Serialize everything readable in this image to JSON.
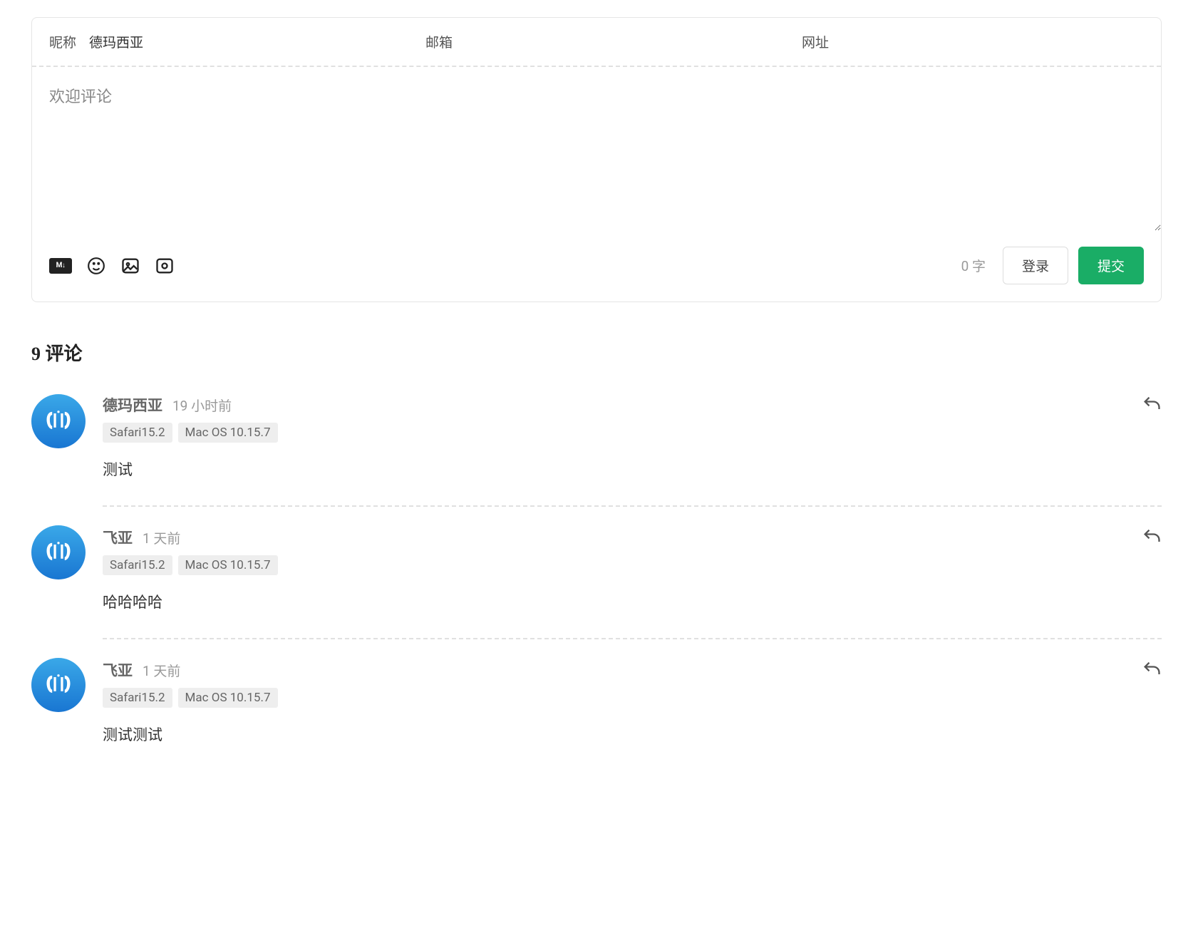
{
  "form": {
    "nickname_label": "昵称",
    "nickname_value": "德玛西亚",
    "email_label": "邮箱",
    "url_label": "网址",
    "textarea_placeholder": "欢迎评论",
    "word_count": "0 字",
    "login_label": "登录",
    "submit_label": "提交"
  },
  "comments_header": "9 评论",
  "comments": [
    {
      "author": "德玛西亚",
      "time": "19 小时前",
      "browser": "Safari15.2",
      "os": "Mac OS 10.15.7",
      "content": "测试"
    },
    {
      "author": "飞亚",
      "time": "1 天前",
      "browser": "Safari15.2",
      "os": "Mac OS 10.15.7",
      "content": "哈哈哈哈"
    },
    {
      "author": "飞亚",
      "time": "1 天前",
      "browser": "Safari15.2",
      "os": "Mac OS 10.15.7",
      "content": "测试测试"
    }
  ]
}
